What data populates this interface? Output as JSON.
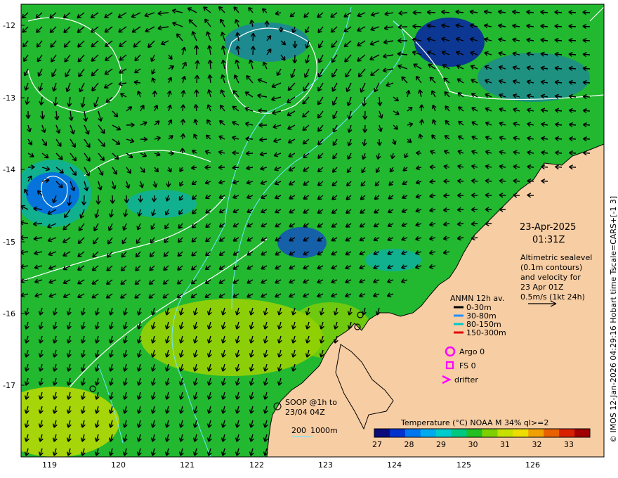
{
  "map": {
    "date": "23-Apr-2025",
    "time": "01:31Z",
    "lat_ticks": [
      "-12",
      "-13",
      "-14",
      "-15",
      "-16",
      "-17"
    ],
    "lon_ticks": [
      "119",
      "120",
      "121",
      "122",
      "123",
      "124",
      "125",
      "126"
    ]
  },
  "info": {
    "line1": "Altimetric sealevel",
    "line2": "(0.1m contours)",
    "line3": "and velocity for",
    "line4": "23 Apr 01Z",
    "line5": "0.5m/s (1kt 24h)"
  },
  "legend": {
    "title": "ANMN 12h av.",
    "items": [
      {
        "label": "0-30m",
        "color": "#000000"
      },
      {
        "label": "30-80m",
        "color": "#1e90ff"
      },
      {
        "label": "80-150m",
        "color": "#00c8c8"
      },
      {
        "label": "150-300m",
        "color": "#e00000"
      }
    ],
    "argo": "Argo 0",
    "fs": "FS 0",
    "drifter": "drifter",
    "soop_line1": "SOOP @1h to",
    "soop_line2": "23/04 04Z",
    "iso_200": "200",
    "iso_1000": "1000m"
  },
  "colorbar": {
    "title": "Temperature (°C) NOAA  M 34% ql>=2",
    "ticks": [
      "27",
      "28",
      "29",
      "30",
      "31",
      "32",
      "33"
    ],
    "colors": [
      "#0a0a7a",
      "#0033cc",
      "#0077ee",
      "#00aaee",
      "#00cccc",
      "#00c880",
      "#22c022",
      "#7ed000",
      "#c8e000",
      "#eedd00",
      "#f0a000",
      "#e86000",
      "#d82000",
      "#a00000"
    ]
  },
  "credit": "© IMOS 12-Jan-2026 04:29:16 Hobart time Tscale=CARS+[-1 3]",
  "colors": {
    "land": "#f7cda3",
    "ocean": "#22b830"
  }
}
